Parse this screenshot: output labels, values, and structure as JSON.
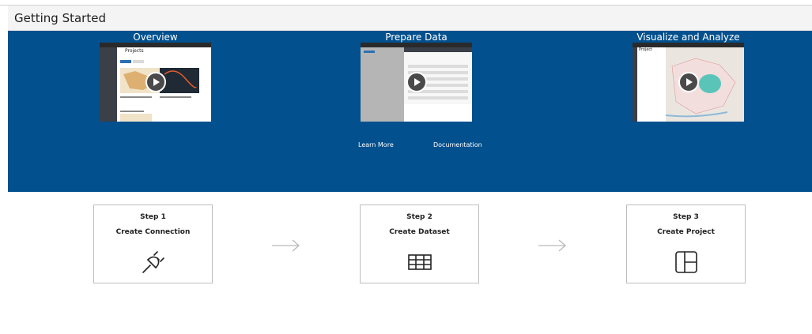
{
  "header": {
    "title": "Getting Started"
  },
  "banner": {
    "videos": [
      {
        "title": "Overview",
        "thumb_heading": "Projects"
      },
      {
        "title": "Prepare Data",
        "thumb_heading": ""
      },
      {
        "title": "Visualize and Analyze",
        "thumb_heading": "Project"
      }
    ],
    "links": {
      "learn_more": "Learn More",
      "documentation": "Documentation"
    }
  },
  "steps": [
    {
      "step": "Step 1",
      "name": "Create Connection",
      "icon": "plug-icon"
    },
    {
      "step": "Step 2",
      "name": "Create Dataset",
      "icon": "table-icon"
    },
    {
      "step": "Step 3",
      "name": "Create Project",
      "icon": "layout-icon"
    }
  ],
  "colors": {
    "banner": "#02508e",
    "header_bg": "#f4f4f4"
  }
}
